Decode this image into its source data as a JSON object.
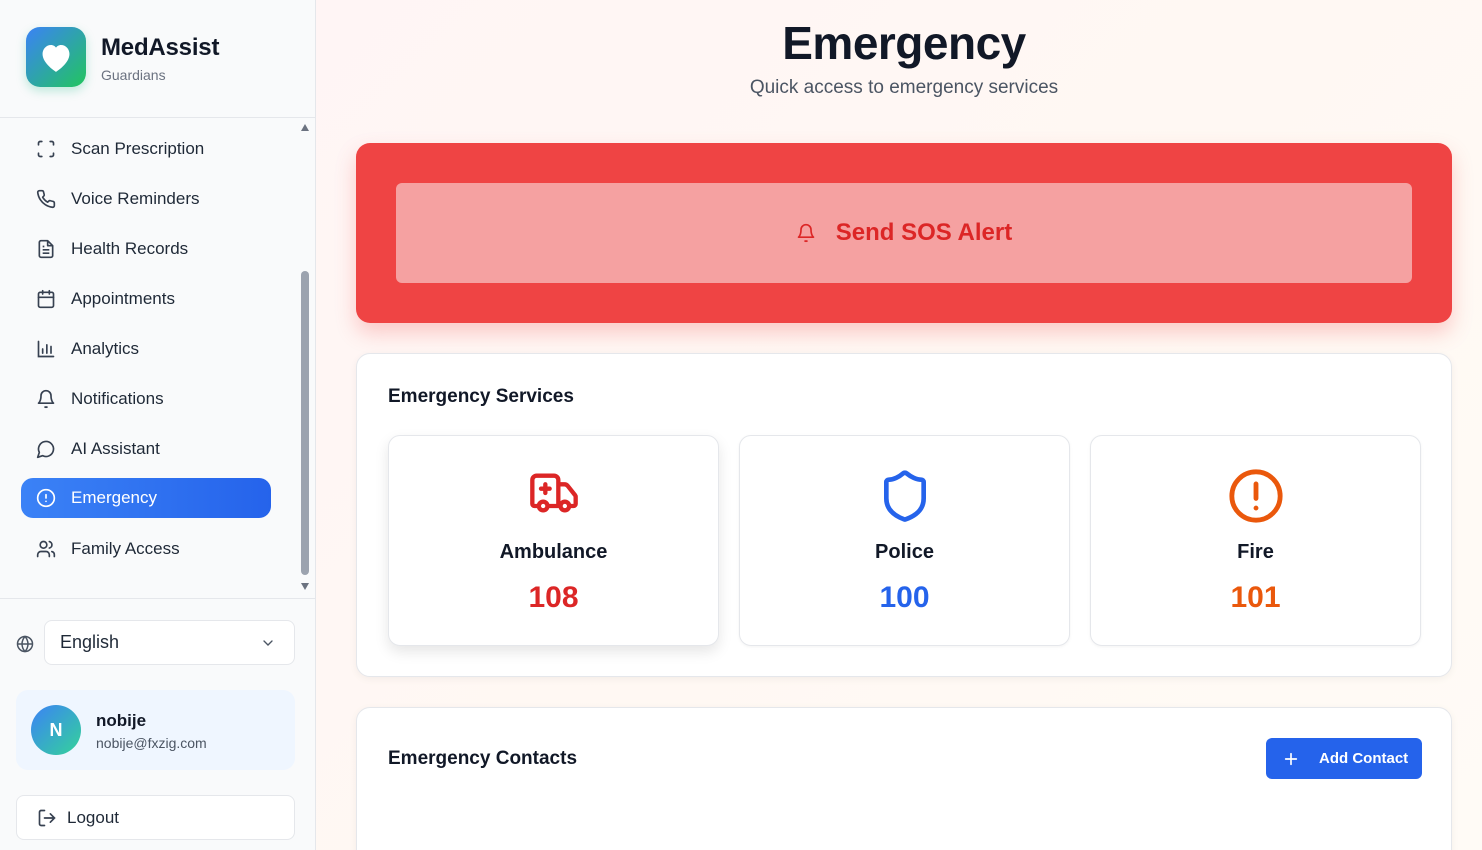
{
  "brand": {
    "name": "MedAssist",
    "subtitle": "Guardians"
  },
  "nav": {
    "items": [
      {
        "label": "Scan Prescription",
        "icon": "scan-icon"
      },
      {
        "label": "Voice Reminders",
        "icon": "phone-icon"
      },
      {
        "label": "Health Records",
        "icon": "file-icon"
      },
      {
        "label": "Appointments",
        "icon": "calendar-icon"
      },
      {
        "label": "Analytics",
        "icon": "bar-chart-icon"
      },
      {
        "label": "Notifications",
        "icon": "bell-icon"
      },
      {
        "label": "AI Assistant",
        "icon": "chat-icon"
      },
      {
        "label": "Emergency",
        "icon": "alert-circle-icon",
        "active": true
      },
      {
        "label": "Family Access",
        "icon": "users-icon"
      }
    ]
  },
  "language": {
    "selected": "English"
  },
  "user": {
    "initial": "N",
    "name": "nobije",
    "email": "nobije@fxzig.com"
  },
  "logout_label": "Logout",
  "page": {
    "title": "Emergency",
    "subtitle": "Quick access to emergency services"
  },
  "sos": {
    "label": "Send SOS Alert"
  },
  "services": {
    "title": "Emergency Services",
    "items": [
      {
        "name": "Ambulance",
        "number": "108",
        "color": "#dc2626",
        "icon": "ambulance-icon"
      },
      {
        "name": "Police",
        "number": "100",
        "color": "#2563eb",
        "icon": "shield-icon"
      },
      {
        "name": "Fire",
        "number": "101",
        "color": "#ea580c",
        "icon": "alert-circle-icon"
      }
    ]
  },
  "contacts": {
    "title": "Emergency Contacts",
    "add_label": "Add Contact"
  },
  "colors": {
    "accent": "#2563eb",
    "sos": "#ef4444",
    "sos_button": "#f5a1a1"
  }
}
